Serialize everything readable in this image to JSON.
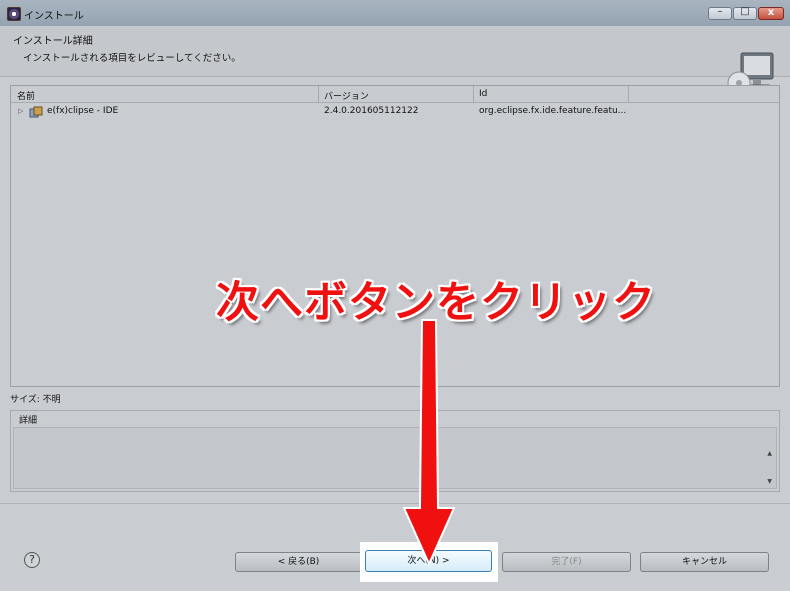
{
  "window": {
    "title": "インストール",
    "controls": {
      "minimize": "–",
      "maximize": "□",
      "close": "x"
    }
  },
  "header": {
    "title": "インストール詳細",
    "subtitle": "インストールされる項目をレビューしてください。",
    "icon": "install-monitor-icon"
  },
  "table": {
    "columns": [
      "名前",
      "バージョン",
      "Id"
    ],
    "rows": [
      {
        "name": "e(fx)clipse - IDE",
        "version": "2.4.0.201605112122",
        "id": "org.eclipse.fx.ide.feature.featu..."
      }
    ]
  },
  "size_label": "サイズ: 不明",
  "details": {
    "label": "詳細"
  },
  "buttons": {
    "help": "?",
    "back": "< 戻る(B)",
    "next": "次へ(N) >",
    "finish": "完了(F)",
    "cancel": "キャンセル"
  },
  "annotation": {
    "text": "次へボタンをクリック",
    "color": "#f01010"
  }
}
